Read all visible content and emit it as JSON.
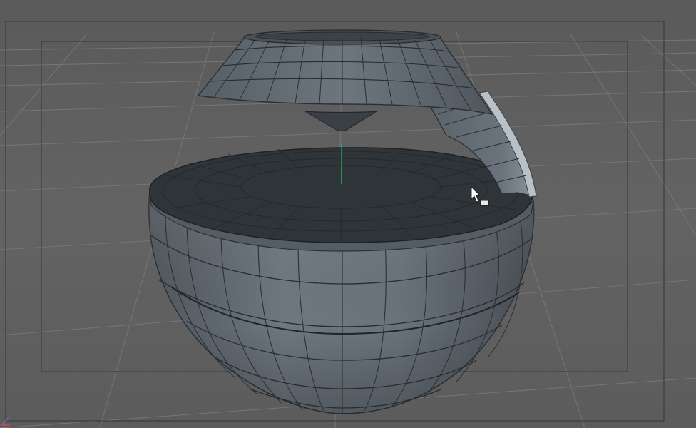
{
  "viewport": {
    "background": "#5f5f5f",
    "grid_color": "#727272",
    "safe_frame_color": "#3a3a3a",
    "axis_color": "#22c25a"
  },
  "model": {
    "surface_color": "#616a72",
    "top_face_color": "#2f3438",
    "wire_color": "#252b30",
    "highlight_color": "#b9c0c6"
  },
  "cursor": {
    "icon": "arrow-with-box-cursor-icon"
  }
}
